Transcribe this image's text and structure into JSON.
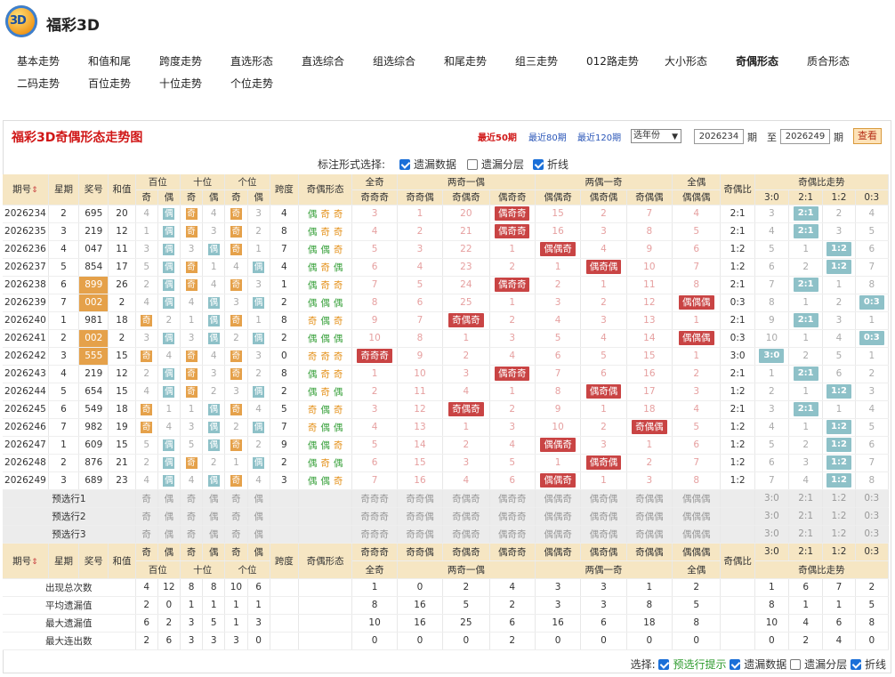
{
  "site": {
    "title": "福彩3D",
    "logo_text": "3D"
  },
  "nav": [
    {
      "label": "基本走势"
    },
    {
      "label": "和值和尾"
    },
    {
      "label": "跨度走势"
    },
    {
      "label": "直选形态"
    },
    {
      "label": "直选综合"
    },
    {
      "label": "组选综合"
    },
    {
      "label": "和尾走势"
    },
    {
      "label": "组三走势"
    },
    {
      "label": "012路走势"
    },
    {
      "label": "大小形态"
    },
    {
      "label": "奇偶形态",
      "active": true
    },
    {
      "label": "质合形态"
    },
    {
      "label": "二码走势"
    },
    {
      "label": "百位走势"
    },
    {
      "label": "十位走势"
    },
    {
      "label": "个位走势"
    }
  ],
  "panel": {
    "title": "福彩3D奇偶形态走势图",
    "recent50": "最近50期",
    "recent80": "最近80期",
    "recent120": "最近120期",
    "year_select": "选年份",
    "from": "2026234",
    "to_label": "至",
    "to": "2026249",
    "qi": "期",
    "query": "查看"
  },
  "options": {
    "label": "标注形式选择:",
    "miss": "遗漏数据",
    "layer": "遗漏分层",
    "line": "折线"
  },
  "headers": {
    "issue": "期号",
    "week": "星期",
    "num": "奖号",
    "sum": "和值",
    "bai": "百位",
    "shi": "十位",
    "ge": "个位",
    "odd": "奇",
    "even": "偶",
    "span": "跨度",
    "form": "奇偶形态",
    "g_all_odd": "全奇",
    "g_two_odd": "两奇一偶",
    "g_two_even": "两偶一奇",
    "g_all_even": "全偶",
    "ratio": "奇偶比",
    "ratio_trend": "奇偶比走势",
    "sort_icon": "sort-icon",
    "forms": [
      "奇奇奇",
      "奇奇偶",
      "奇偶奇",
      "偶奇奇",
      "偶偶奇",
      "偶奇偶",
      "奇偶偶",
      "偶偶偶"
    ],
    "ratios": [
      "3:0",
      "2:1",
      "1:2",
      "0:3"
    ]
  },
  "rows": [
    {
      "issue": "2026234",
      "week": "2",
      "num": "695",
      "sum": "20",
      "bai": "偶",
      "shi": "奇",
      "ge": "奇",
      "span": "4",
      "form": "偶奇奇",
      "f": [
        "3",
        "1",
        "20",
        "偶奇奇",
        "15",
        "2",
        "7",
        "4"
      ],
      "ratio": "2:1",
      "r": [
        "3",
        "2:1",
        "2",
        "4"
      ]
    },
    {
      "issue": "2026235",
      "week": "3",
      "num": "219",
      "sum": "12",
      "bai": "偶",
      "shi": "奇",
      "ge": "奇",
      "span": "8",
      "form": "偶奇奇",
      "f": [
        "4",
        "2",
        "21",
        "偶奇奇",
        "16",
        "3",
        "8",
        "5"
      ],
      "ratio": "2:1",
      "r": [
        "4",
        "2:1",
        "3",
        "5"
      ]
    },
    {
      "issue": "2026236",
      "week": "4",
      "num": "047",
      "sum": "11",
      "bai": "偶",
      "shi": "偶",
      "ge": "奇",
      "span": "7",
      "form": "偶偶奇",
      "f": [
        "5",
        "3",
        "22",
        "1",
        "偶偶奇",
        "4",
        "9",
        "6"
      ],
      "ratio": "1:2",
      "r": [
        "5",
        "1",
        "1:2",
        "6"
      ]
    },
    {
      "issue": "2026237",
      "week": "5",
      "num": "854",
      "sum": "17",
      "bai": "偶",
      "shi": "奇",
      "ge": "偶",
      "span": "4",
      "form": "偶奇偶",
      "f": [
        "6",
        "4",
        "23",
        "2",
        "1",
        "偶奇偶",
        "10",
        "7"
      ],
      "ratio": "1:2",
      "r": [
        "6",
        "2",
        "1:2",
        "7"
      ]
    },
    {
      "issue": "2026238",
      "week": "6",
      "num": "899",
      "sum": "26",
      "bai": "偶",
      "shi": "奇",
      "ge": "奇",
      "span": "1",
      "form": "偶奇奇",
      "f": [
        "7",
        "5",
        "24",
        "偶奇奇",
        "2",
        "1",
        "11",
        "8"
      ],
      "ratio": "2:1",
      "r": [
        "7",
        "2:1",
        "1",
        "8"
      ],
      "hl": true
    },
    {
      "issue": "2026239",
      "week": "7",
      "num": "002",
      "sum": "2",
      "bai": "偶",
      "shi": "偶",
      "ge": "偶",
      "span": "2",
      "form": "偶偶偶",
      "f": [
        "8",
        "6",
        "25",
        "1",
        "3",
        "2",
        "12",
        "偶偶偶"
      ],
      "ratio": "0:3",
      "r": [
        "8",
        "1",
        "2",
        "0:3"
      ],
      "hl": true
    },
    {
      "issue": "2026240",
      "week": "1",
      "num": "981",
      "sum": "18",
      "bai": "奇",
      "shi": "偶",
      "ge": "奇",
      "span": "8",
      "form": "奇偶奇",
      "f": [
        "9",
        "7",
        "奇偶奇",
        "2",
        "4",
        "3",
        "13",
        "1"
      ],
      "ratio": "2:1",
      "r": [
        "9",
        "2:1",
        "3",
        "1"
      ]
    },
    {
      "issue": "2026241",
      "week": "2",
      "num": "002",
      "sum": "2",
      "bai": "偶",
      "shi": "偶",
      "ge": "偶",
      "span": "2",
      "form": "偶偶偶",
      "f": [
        "10",
        "8",
        "1",
        "3",
        "5",
        "4",
        "14",
        "偶偶偶"
      ],
      "ratio": "0:3",
      "r": [
        "10",
        "1",
        "4",
        "0:3"
      ],
      "hl": true
    },
    {
      "issue": "2026242",
      "week": "3",
      "num": "555",
      "sum": "15",
      "bai": "奇",
      "shi": "奇",
      "ge": "奇",
      "span": "0",
      "form": "奇奇奇",
      "f": [
        "奇奇奇",
        "9",
        "2",
        "4",
        "6",
        "5",
        "15",
        "1"
      ],
      "ratio": "3:0",
      "r": [
        "3:0",
        "2",
        "5",
        "1"
      ],
      "hl": true
    },
    {
      "issue": "2026243",
      "week": "4",
      "num": "219",
      "sum": "12",
      "bai": "偶",
      "shi": "奇",
      "ge": "奇",
      "span": "8",
      "form": "偶奇奇",
      "f": [
        "1",
        "10",
        "3",
        "偶奇奇",
        "7",
        "6",
        "16",
        "2"
      ],
      "ratio": "2:1",
      "r": [
        "1",
        "2:1",
        "6",
        "2"
      ]
    },
    {
      "issue": "2026244",
      "week": "5",
      "num": "654",
      "sum": "15",
      "bai": "偶",
      "shi": "奇",
      "ge": "偶",
      "span": "2",
      "form": "偶奇偶",
      "f": [
        "2",
        "11",
        "4",
        "1",
        "8",
        "偶奇偶",
        "17",
        "3"
      ],
      "ratio": "1:2",
      "r": [
        "2",
        "1",
        "1:2",
        "3"
      ]
    },
    {
      "issue": "2026245",
      "week": "6",
      "num": "549",
      "sum": "18",
      "bai": "奇",
      "shi": "偶",
      "ge": "奇",
      "span": "5",
      "form": "奇偶奇",
      "f": [
        "3",
        "12",
        "奇偶奇",
        "2",
        "9",
        "1",
        "18",
        "4"
      ],
      "ratio": "2:1",
      "r": [
        "3",
        "2:1",
        "1",
        "4"
      ]
    },
    {
      "issue": "2026246",
      "week": "7",
      "num": "982",
      "sum": "19",
      "bai": "奇",
      "shi": "偶",
      "ge": "偶",
      "span": "7",
      "form": "奇偶偶",
      "f": [
        "4",
        "13",
        "1",
        "3",
        "10",
        "2",
        "奇偶偶",
        "5"
      ],
      "ratio": "1:2",
      "r": [
        "4",
        "1",
        "1:2",
        "5"
      ]
    },
    {
      "issue": "2026247",
      "week": "1",
      "num": "609",
      "sum": "15",
      "bai": "偶",
      "shi": "偶",
      "ge": "奇",
      "span": "9",
      "form": "偶偶奇",
      "f": [
        "5",
        "14",
        "2",
        "4",
        "偶偶奇",
        "3",
        "1",
        "6"
      ],
      "ratio": "1:2",
      "r": [
        "5",
        "2",
        "1:2",
        "6"
      ]
    },
    {
      "issue": "2026248",
      "week": "2",
      "num": "876",
      "sum": "21",
      "bai": "偶",
      "shi": "奇",
      "ge": "偶",
      "span": "2",
      "form": "偶奇偶",
      "f": [
        "6",
        "15",
        "3",
        "5",
        "1",
        "偶奇偶",
        "2",
        "7"
      ],
      "ratio": "1:2",
      "r": [
        "6",
        "3",
        "1:2",
        "7"
      ]
    },
    {
      "issue": "2026249",
      "week": "3",
      "num": "689",
      "sum": "23",
      "bai": "偶",
      "shi": "偶",
      "ge": "奇",
      "span": "3",
      "form": "偶偶奇",
      "f": [
        "7",
        "16",
        "4",
        "6",
        "偶偶奇",
        "1",
        "3",
        "8"
      ],
      "ratio": "1:2",
      "r": [
        "7",
        "4",
        "1:2",
        "8"
      ]
    }
  ],
  "preselect": [
    "预选行1",
    "预选行2",
    "预选行3"
  ],
  "stats": [
    {
      "label": "出现总次数",
      "pos": [
        "4",
        "12",
        "8",
        "8",
        "10",
        "6"
      ],
      "f": [
        "1",
        "0",
        "2",
        "4",
        "3",
        "3",
        "1",
        "2"
      ],
      "r": [
        "1",
        "6",
        "7",
        "2"
      ]
    },
    {
      "label": "平均遗漏值",
      "pos": [
        "2",
        "0",
        "1",
        "1",
        "1",
        "1"
      ],
      "f": [
        "8",
        "16",
        "5",
        "2",
        "3",
        "3",
        "8",
        "5"
      ],
      "r": [
        "8",
        "1",
        "1",
        "5"
      ]
    },
    {
      "label": "最大遗漏值",
      "pos": [
        "6",
        "2",
        "3",
        "5",
        "1",
        "3"
      ],
      "f": [
        "10",
        "16",
        "25",
        "6",
        "16",
        "6",
        "18",
        "8"
      ],
      "r": [
        "10",
        "4",
        "6",
        "8"
      ]
    },
    {
      "label": "最大连出数",
      "pos": [
        "2",
        "6",
        "3",
        "3",
        "3",
        "0"
      ],
      "f": [
        "0",
        "0",
        "0",
        "2",
        "0",
        "0",
        "0",
        "0"
      ],
      "r": [
        "0",
        "2",
        "4",
        "0"
      ]
    }
  ],
  "footer": {
    "label": "选择:",
    "pre": "预选行提示",
    "miss": "遗漏数据",
    "layer": "遗漏分层",
    "line": "折线"
  }
}
